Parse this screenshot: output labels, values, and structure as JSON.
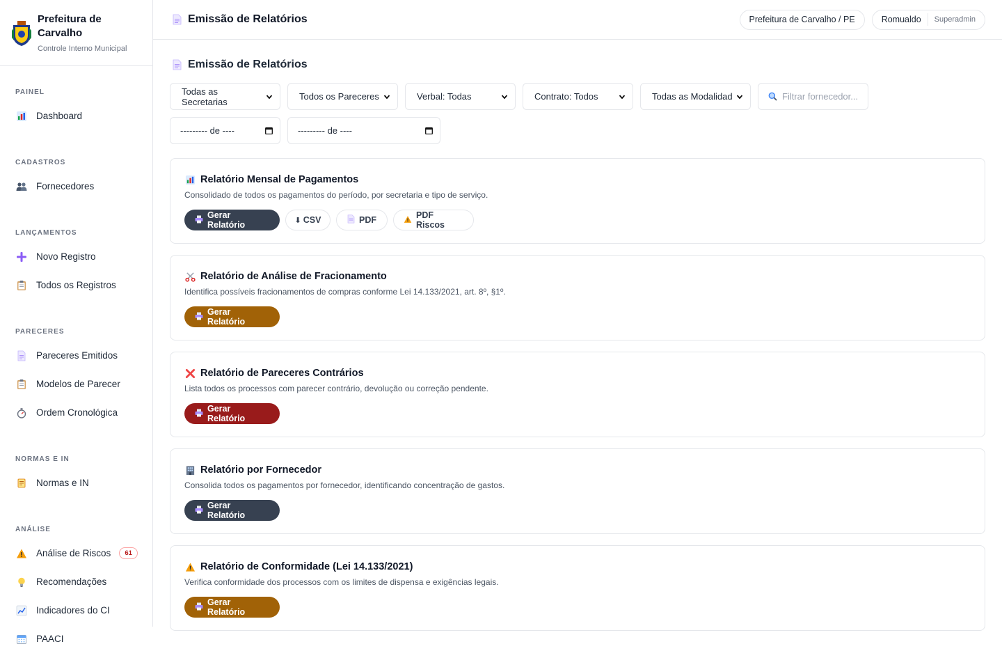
{
  "brand": {
    "name": "Prefeitura de Carvalho",
    "subtitle": "Controle Interno Municipal"
  },
  "sidebar": {
    "sections": [
      {
        "title": "PAINEL",
        "items": [
          {
            "label": "Dashboard",
            "icon": "bar-chart-icon"
          }
        ]
      },
      {
        "title": "CADASTROS",
        "items": [
          {
            "label": "Fornecedores",
            "icon": "users-icon"
          }
        ]
      },
      {
        "title": "LANÇAMENTOS",
        "items": [
          {
            "label": "Novo Registro",
            "icon": "plus-icon"
          },
          {
            "label": "Todos os Registros",
            "icon": "clipboard-icon"
          }
        ]
      },
      {
        "title": "PARECERES",
        "items": [
          {
            "label": "Pareceres Emitidos",
            "icon": "document-icon"
          },
          {
            "label": "Modelos de Parecer",
            "icon": "clipboard-icon"
          },
          {
            "label": "Ordem Cronológica",
            "icon": "stopwatch-icon"
          }
        ]
      },
      {
        "title": "NORMAS E IN",
        "items": [
          {
            "label": "Normas e IN",
            "icon": "scroll-icon"
          }
        ]
      },
      {
        "title": "ANÁLISE",
        "items": [
          {
            "label": "Análise de Riscos",
            "icon": "warning-icon",
            "badge": "61"
          },
          {
            "label": "Recomendações",
            "icon": "lightbulb-icon"
          },
          {
            "label": "Indicadores do CI",
            "icon": "trend-icon"
          },
          {
            "label": "PAACI",
            "icon": "calendar-icon"
          }
        ]
      }
    ]
  },
  "header": {
    "title": "Emissão de Relatórios",
    "org": "Prefeitura de Carvalho / PE",
    "user": "Romualdo",
    "role": "Superadmin"
  },
  "page": {
    "title": "Emissão de Relatórios"
  },
  "filters": {
    "secretarias": "Todas as Secretarias",
    "pareceres": "Todos os Pareceres",
    "verbal": "Verbal: Todas",
    "contrato": "Contrato: Todos",
    "modalidades": "Todas as Modalidad",
    "search_placeholder": "Filtrar fornecedor...",
    "date_from": "--------- de ----",
    "date_to": "--------- de ----"
  },
  "reports": [
    {
      "title": "Relatório Mensal de Pagamentos",
      "description": "Consolidado de todos os pagamentos do período, por secretaria e tipo de serviço.",
      "generate": "Gerar Relatório",
      "csv": "CSV",
      "pdf": "PDF",
      "pdf_risks": "PDF Riscos",
      "color": "#374151"
    },
    {
      "title": "Relatório de Análise de Fracionamento",
      "description": "Identifica possíveis fracionamentos de compras conforme Lei 14.133/2021, art. 8º, §1º.",
      "generate": "Gerar Relatório",
      "color": "#a16207"
    },
    {
      "title": "Relatório de Pareceres Contrários",
      "description": "Lista todos os processos com parecer contrário, devolução ou correção pendente.",
      "generate": "Gerar Relatório",
      "color": "#991b1b"
    },
    {
      "title": "Relatório por Fornecedor",
      "description": "Consolida todos os pagamentos por fornecedor, identificando concentração de gastos.",
      "generate": "Gerar Relatório",
      "color": "#374151"
    },
    {
      "title": "Relatório de Conformidade (Lei 14.133/2021)",
      "description": "Verifica conformidade dos processos com os limites de dispensa e exigências legais.",
      "generate": "Gerar Relatório",
      "color": "#a16207"
    }
  ]
}
